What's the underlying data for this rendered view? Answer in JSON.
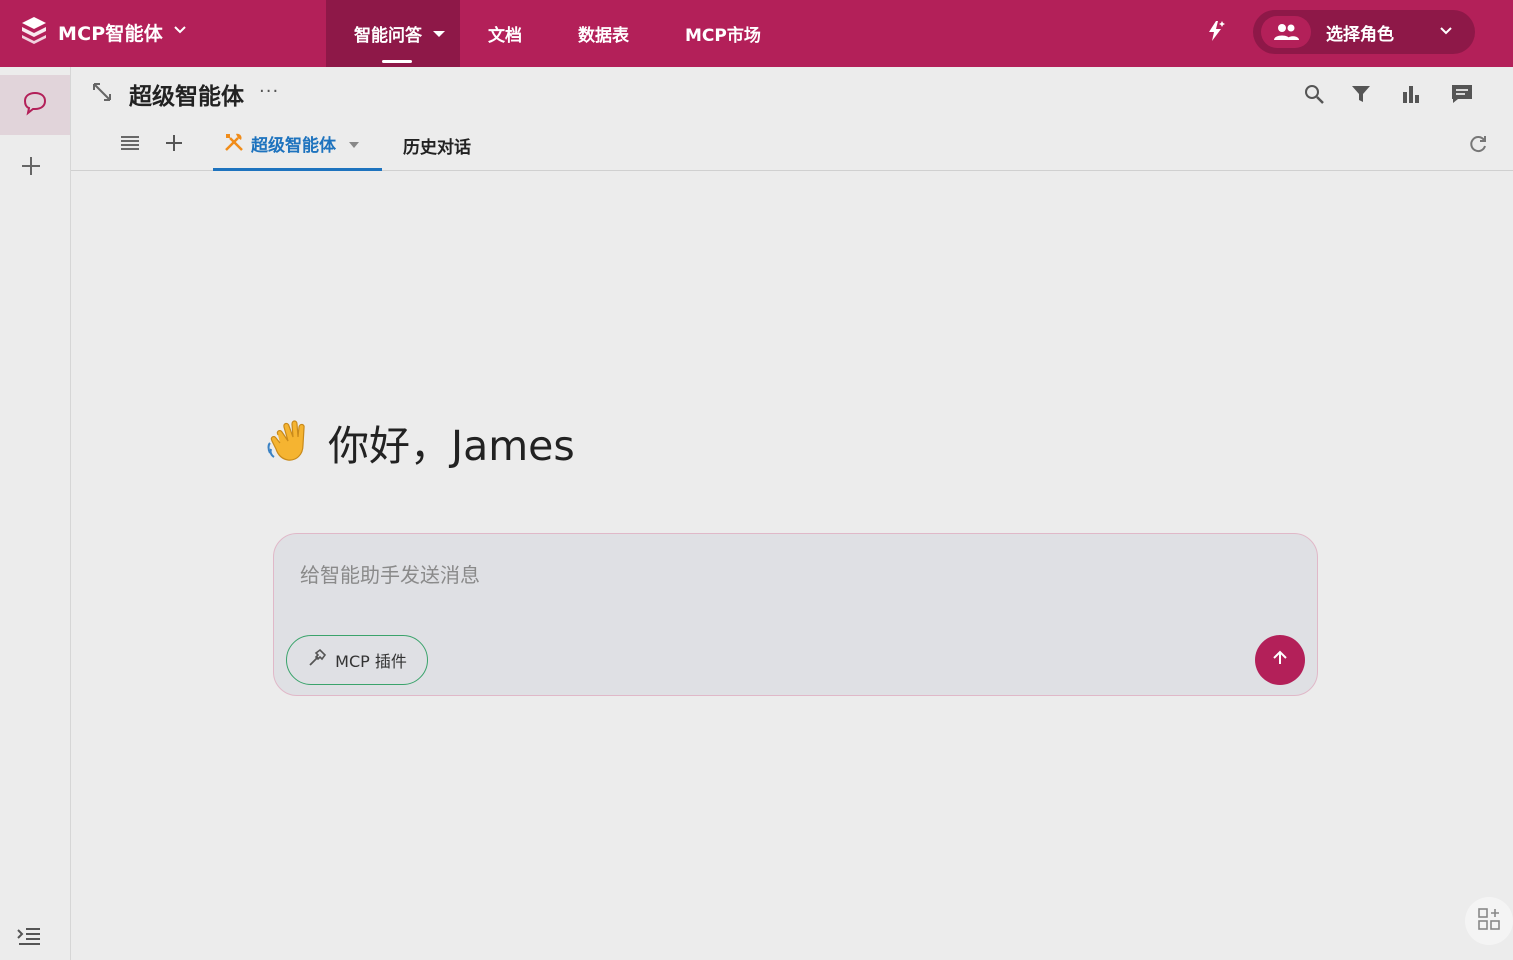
{
  "topbar": {
    "brand": "MCP智能体",
    "nav": [
      {
        "label": "智能问答"
      },
      {
        "label": "文档"
      },
      {
        "label": "数据表"
      },
      {
        "label": "MCP市场"
      }
    ],
    "role_label": "选择角色"
  },
  "header": {
    "title": "超级智能体",
    "more": "···"
  },
  "tabs": {
    "active_label": "超级智能体",
    "history_label": "历史对话"
  },
  "greeting": {
    "emoji": "👋",
    "text": "你好，James"
  },
  "composer": {
    "placeholder": "给智能助手发送消息",
    "mcp_label": "MCP 插件"
  },
  "colors": {
    "brand": "#b32059",
    "brand_dark": "#8e1848",
    "tab_active": "#1e73be",
    "mcp_border": "#3aa36b"
  }
}
